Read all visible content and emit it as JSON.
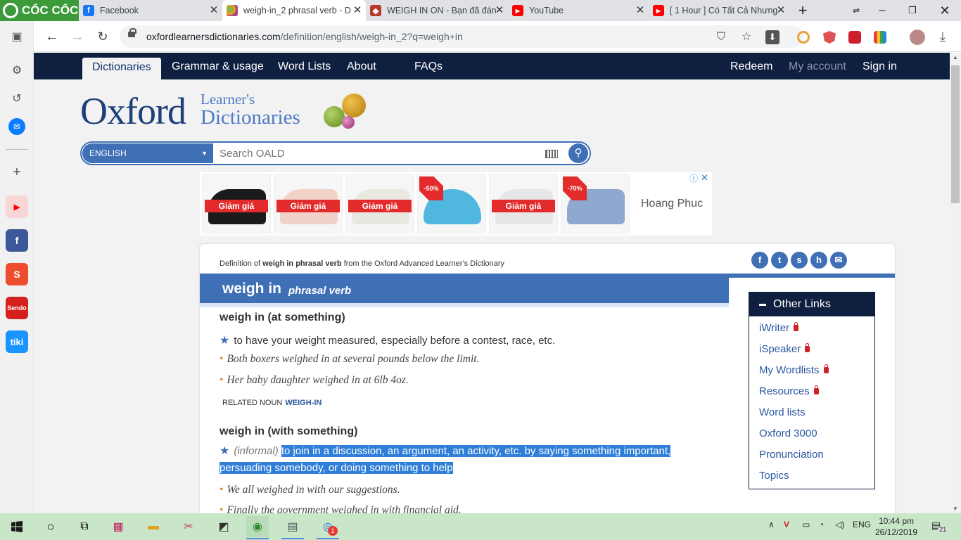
{
  "browser": {
    "brand": "CỐC CỐC",
    "tabs": [
      {
        "title": "Facebook",
        "icon": "facebook-icon",
        "active": false
      },
      {
        "title": "weigh-in_2 phrasal verb - D",
        "icon": "oxford-icon",
        "active": true
      },
      {
        "title": "WEIGH IN ON - Bạn đã đán",
        "icon": "shield-icon",
        "active": false
      },
      {
        "title": "YouTube",
        "icon": "youtube-icon",
        "active": false
      },
      {
        "title": "[ 1 Hour ] Có Tất Cả Nhưng",
        "icon": "youtube-icon",
        "active": false
      }
    ],
    "url_host": "oxfordlearnersdictionaries.com",
    "url_path": "/definition/english/weigh-in_2?q=weigh+in"
  },
  "site_nav": {
    "items": [
      "Dictionaries",
      "Grammar & usage",
      "Word Lists",
      "About",
      "FAQs"
    ],
    "right": [
      "Redeem",
      "My account",
      "Sign in"
    ]
  },
  "logo": {
    "main": "Oxford",
    "sub1": "Learner's",
    "sub2": "Dictionaries"
  },
  "search": {
    "language": "ENGLISH",
    "placeholder": "Search OALD"
  },
  "ad": {
    "sale_label": "Giảm giá",
    "badge_50": "-50%",
    "badge_70": "-70%",
    "brand": "Hoang Phuc"
  },
  "entry": {
    "def_of_prefix": "Definition of",
    "def_of_word": "weigh in phrasal verb",
    "def_of_suffix": "from the Oxford Advanced Learner's Dictionary",
    "headword": "weigh in",
    "pos": "phrasal verb",
    "sense1": {
      "shortcut": "weigh in (at something)",
      "definition": "to have your weight measured, especially before a contest, race, etc.",
      "examples": [
        "Both boxers weighed in at several pounds below the limit.",
        "Her baby daughter weighed in at 6lb 4oz."
      ]
    },
    "related": {
      "label": "Related noun",
      "word": "weigh-in"
    },
    "sense2": {
      "shortcut": "weigh in (with something)",
      "register": "(informal)",
      "definition_line1": "to join in a discussion, an argument, an activity, etc. by saying something important,",
      "definition_line2": "persuading somebody, or doing something to help",
      "examples": [
        "We all weighed in with our suggestions.",
        "Finally the government weighed in with financial aid."
      ]
    }
  },
  "other_links": {
    "title": "Other Links",
    "items": [
      {
        "label": "iWriter",
        "locked": true
      },
      {
        "label": "iSpeaker",
        "locked": true
      },
      {
        "label": "My Wordlists",
        "locked": true
      },
      {
        "label": "Resources",
        "locked": true
      },
      {
        "label": "Word lists",
        "locked": false
      },
      {
        "label": "Oxford 3000",
        "locked": false
      },
      {
        "label": "Pronunciation",
        "locked": false
      },
      {
        "label": "Topics",
        "locked": false
      }
    ]
  },
  "taskbar": {
    "lang": "ENG",
    "time": "10:44 pm",
    "date": "26/12/2019",
    "notif_count": "21",
    "app_badge": "1"
  },
  "colors": {
    "oxford_blue": "#3f6fb5",
    "navy": "#0f1f3f",
    "highlight": "#2f7fd8",
    "coccoc_green": "#3c9a3b"
  }
}
